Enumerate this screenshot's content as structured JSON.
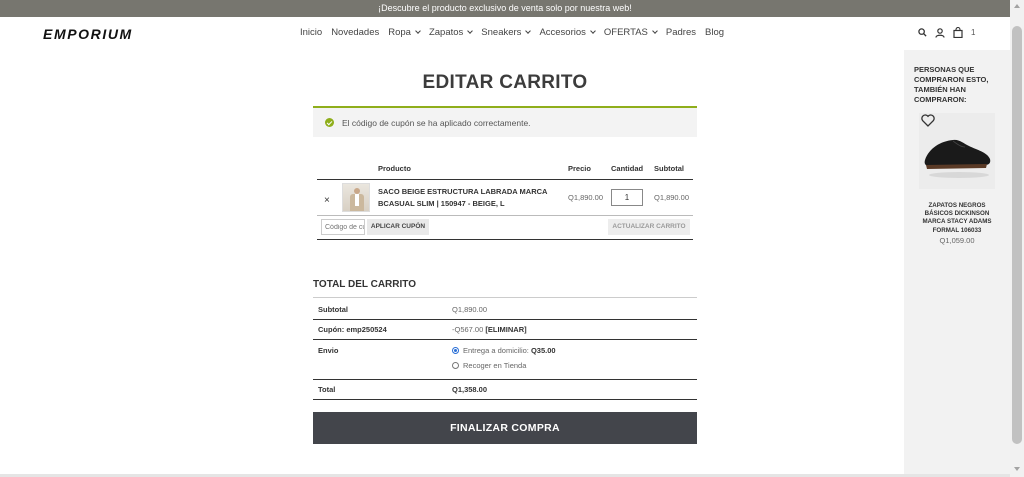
{
  "topbar": {
    "text": "¡Descubre el producto exclusivo de venta solo por nuestra web!"
  },
  "header": {
    "logo": "EMPORIUM",
    "nav": [
      {
        "label": "Inicio",
        "dropdown": false
      },
      {
        "label": "Novedades",
        "dropdown": false
      },
      {
        "label": "Ropa",
        "dropdown": true
      },
      {
        "label": "Zapatos",
        "dropdown": true
      },
      {
        "label": "Sneakers",
        "dropdown": true
      },
      {
        "label": "Accesorios",
        "dropdown": true
      },
      {
        "label": "OFERTAS",
        "dropdown": true
      },
      {
        "label": "Padres",
        "dropdown": false
      },
      {
        "label": "Blog",
        "dropdown": false
      }
    ],
    "cart_count": "1"
  },
  "page": {
    "title": "EDITAR CARRITO",
    "notice": "El código de cupón se ha aplicado correctamente."
  },
  "cart": {
    "headers": {
      "product": "Producto",
      "price": "Precio",
      "quantity": "Cantidad",
      "subtotal": "Subtotal"
    },
    "items": [
      {
        "remove": "×",
        "name": "SACO BEIGE ESTRUCTURA LABRADA MARCA BCASUAL SLIM | 150947 - BEIGE, L",
        "price": "Q1,890.00",
        "quantity": "1",
        "subtotal": "Q1,890.00"
      }
    ],
    "coupon_placeholder": "Código de cupón",
    "apply_coupon": "APLICAR CUPÓN",
    "update_cart": "ACTUALIZAR CARRITO"
  },
  "totals": {
    "title": "TOTAL DEL CARRITO",
    "subtotal_label": "Subtotal",
    "subtotal_value": "Q1,890.00",
    "coupon_label": "Cupón: emp250524",
    "coupon_value": "-Q567.00",
    "coupon_remove": "[ELIMINAR]",
    "shipping_label": "Envio",
    "shipping_options": [
      {
        "label": "Entrega a domicilio:",
        "price": "Q35.00",
        "selected": true
      },
      {
        "label": "Recoger en Tienda",
        "price": "",
        "selected": false
      }
    ],
    "total_label": "Total",
    "total_value": "Q1,358.00",
    "checkout": "FINALIZAR COMPRA"
  },
  "sidebar": {
    "title": "PERSONAS QUE COMPRARON ESTO, TAMBIÉN HAN COMPRARON:",
    "product_name": "ZAPATOS NEGROS BÁSICOS DICKINSON MARCA STACY ADAMS FORMAL 106033",
    "product_price": "Q1,059.00"
  },
  "colors": {
    "accent": "#8fae1b",
    "checkout_bg": "#43454b",
    "topbar_bg": "#77766f"
  }
}
